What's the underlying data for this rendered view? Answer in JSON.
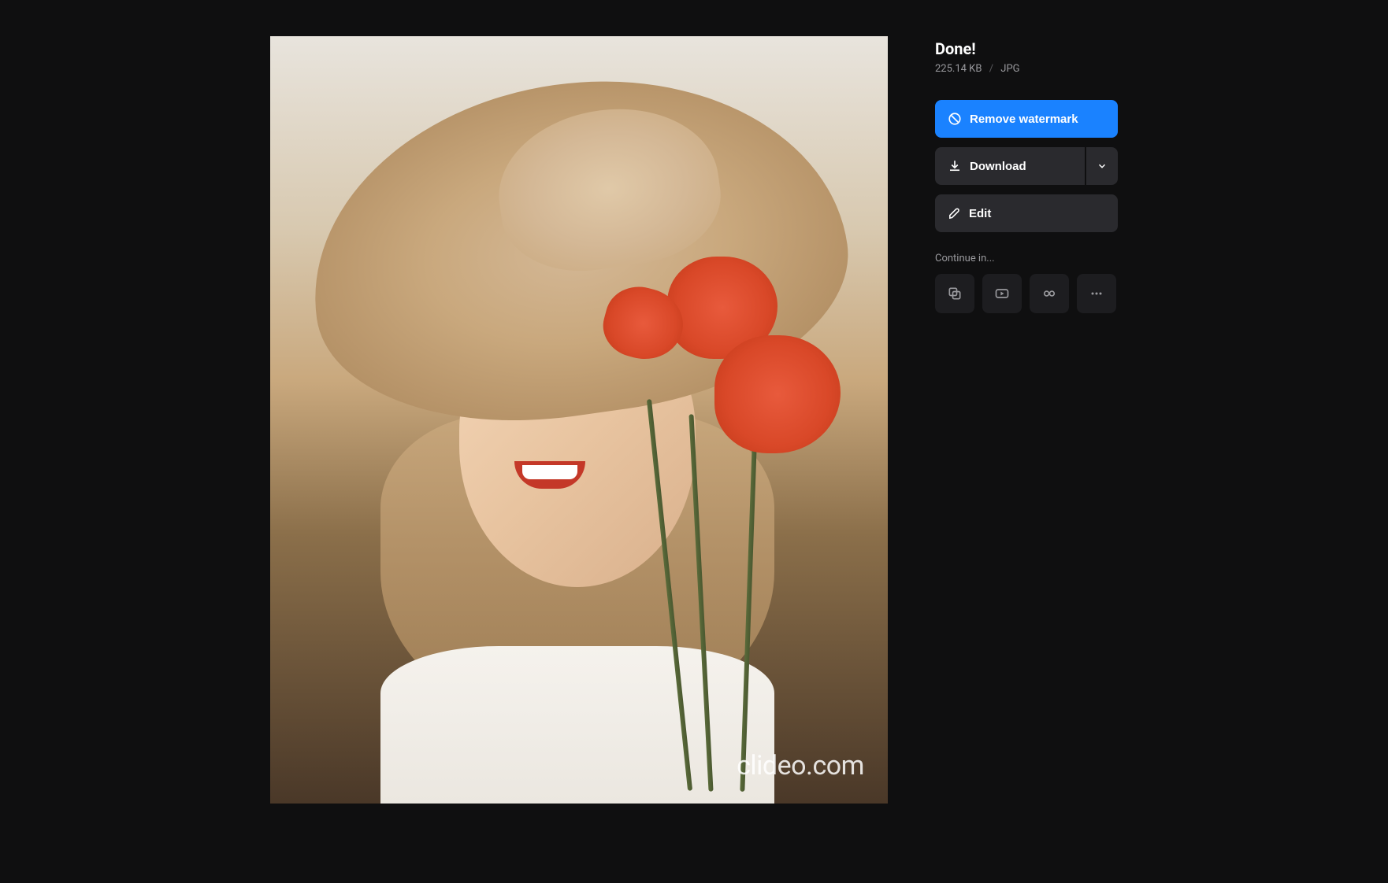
{
  "header": {
    "title": "Done!",
    "file_size": "225.14 KB",
    "file_format": "JPG"
  },
  "actions": {
    "remove_watermark": "Remove watermark",
    "download": "Download",
    "edit": "Edit"
  },
  "continue": {
    "label": "Continue in...",
    "icons": [
      "copy-stack-icon",
      "video-play-icon",
      "link-icon",
      "more-icon"
    ]
  },
  "image": {
    "watermark_text": "clideo.com"
  }
}
